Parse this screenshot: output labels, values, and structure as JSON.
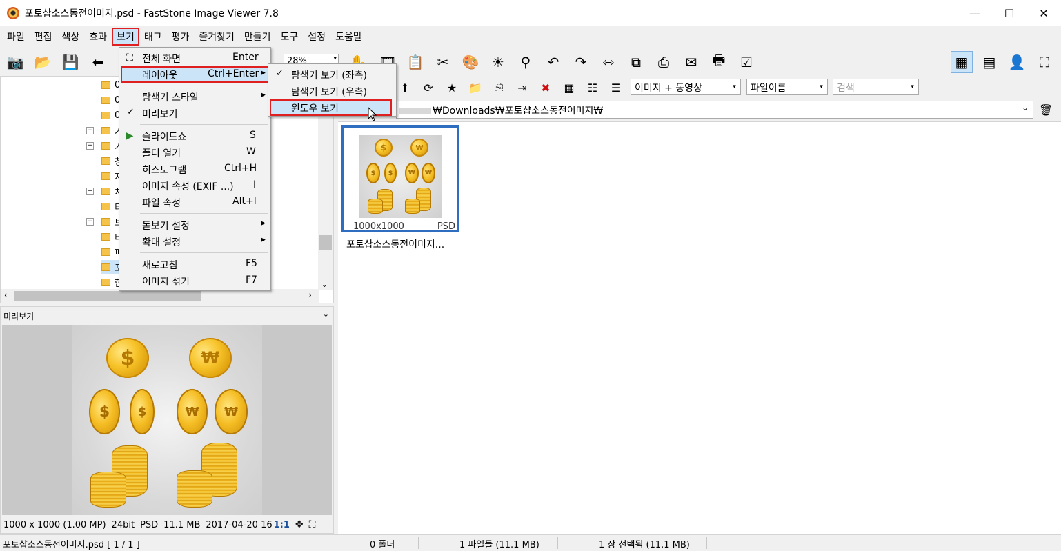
{
  "window": {
    "title": "포토샵소스동전이미지.psd  -  FastStone Image Viewer 7.8",
    "minimize": "—",
    "maximize": "☐",
    "close": "✕"
  },
  "menubar": [
    "파일",
    "편집",
    "색상",
    "효과",
    "보기",
    "태그",
    "평가",
    "즐겨찾기",
    "만들기",
    "도구",
    "설정",
    "도움말"
  ],
  "toolbar": {
    "zoom_value": "28%",
    "icons": [
      "camera-icon",
      "open-folder-icon",
      "save-icon",
      "back-icon"
    ]
  },
  "view_menu": {
    "items": [
      {
        "label": "전체 화면",
        "shortcut": "Enter",
        "icon": "fullscreen-icon"
      },
      {
        "label": "레이아웃",
        "shortcut": "Ctrl+Enter",
        "submenu": true,
        "highlighted": true
      },
      {
        "label": "탐색기 스타일",
        "submenu": true
      },
      {
        "label": "미리보기",
        "checked": true
      },
      {
        "label": "슬라이드쇼",
        "shortcut": "S",
        "icon": "slideshow-icon"
      },
      {
        "label": "폴더 열기",
        "shortcut": "W"
      },
      {
        "label": "히스토그램",
        "shortcut": "Ctrl+H"
      },
      {
        "label": "이미지 속성 (EXIF ...)",
        "shortcut": "I"
      },
      {
        "label": "파일 속성",
        "shortcut": "Alt+I"
      },
      {
        "label": "돋보기 설정",
        "submenu": true
      },
      {
        "label": "확대 설정",
        "submenu": true
      },
      {
        "label": "새로고침",
        "shortcut": "F5"
      },
      {
        "label": "이미지 섞기",
        "shortcut": "F7"
      }
    ]
  },
  "layout_submenu": {
    "items": [
      {
        "label": "탐색기 보기 (좌측)",
        "checked": true
      },
      {
        "label": "탐색기 보기 (우측)"
      },
      {
        "label": "윈도우 보기",
        "highlighted": true
      }
    ]
  },
  "right_pane": {
    "filter_dropdown": "이미지 + 동영상",
    "sort_dropdown": "파일이름",
    "search_placeholder": "검색",
    "path": "₩Downloads₩포토샵소스동전이미지₩",
    "thumbnail": {
      "dimensions": "1000x1000",
      "format": "PSD",
      "name": "포토샵소스동전이미지..."
    }
  },
  "preview": {
    "header": "미리보기",
    "info": {
      "size": "1000 x 1000 (1.00 MP)",
      "bit": "24bit",
      "format": "PSD",
      "filesize": "11.1 MB",
      "date": "2017-04-20 16",
      "ratio": "1:1"
    }
  },
  "tree": {
    "visible_labels": [
      "0",
      "0",
      "0",
      "기",
      "기",
      "칭",
      "지",
      "치",
      "티",
      "트",
      "티",
      "티",
      "파",
      "포",
      "합"
    ]
  },
  "statusbar": {
    "file": "포토샵소스동전이미지.psd [ 1 / 1 ]",
    "folders": "0 폴더",
    "files": "1 파일들 (11.1 MB)",
    "selected": "1 장 선택됨 (11.1 MB)"
  },
  "colors": {
    "selection_blue": "#2f6dc0",
    "highlight_red": "#e02020",
    "menu_highlight": "#cce4f7",
    "coin_gold": "#f7c32a"
  }
}
